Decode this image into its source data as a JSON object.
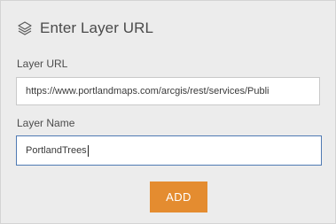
{
  "header": {
    "icon": "layers-icon",
    "title": "Enter Layer URL"
  },
  "form": {
    "url_label": "Layer URL",
    "url_value": "https://www.portlandmaps.com/arcgis/rest/services/Publi",
    "name_label": "Layer Name",
    "name_value": "PortlandTrees"
  },
  "actions": {
    "add_label": "ADD"
  },
  "colors": {
    "accent": "#e48c30",
    "focus_border": "#4f7ab3",
    "background": "#ececec"
  }
}
